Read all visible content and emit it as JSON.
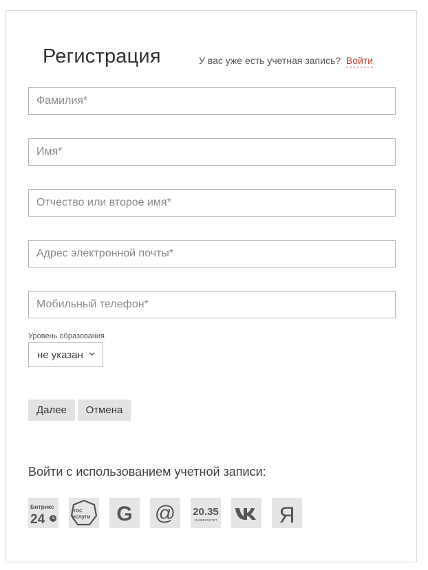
{
  "header": {
    "title": "Регистрация",
    "login_prompt": "У вас уже есть учетная запись?",
    "login_link": "Войти"
  },
  "form": {
    "fields": [
      {
        "placeholder": "Фамилия*",
        "value": ""
      },
      {
        "placeholder": "Имя*",
        "value": ""
      },
      {
        "placeholder": "Отчество или второе имя*",
        "value": ""
      },
      {
        "placeholder": "Адрес электронной почты*",
        "value": ""
      },
      {
        "placeholder": "Мобильный телефон*",
        "value": ""
      }
    ],
    "education": {
      "label": "Уровень образования",
      "selected": "не указан"
    },
    "next_label": "Далее",
    "cancel_label": "Отмена"
  },
  "social": {
    "title": "Войти с использованием учетной записи:",
    "providers": [
      {
        "name": "Bitrix24",
        "icon": "bitrix24-icon",
        "text_top": "Битрикс",
        "text_bottom": "24"
      },
      {
        "name": "Gosuslugi",
        "icon": "gosuslugi-icon",
        "text_top": "гос",
        "text_bottom": "услуги"
      },
      {
        "name": "Google",
        "icon": "google-icon",
        "text": "G"
      },
      {
        "name": "Mail.ru",
        "icon": "mailru-icon",
        "text": "@"
      },
      {
        "name": "Universitet 20.35",
        "icon": "university-2035-icon",
        "text_top": "20.35",
        "text_bottom": "УНИВЕРСИТЕТ"
      },
      {
        "name": "VK",
        "icon": "vk-icon",
        "text": "vk"
      },
      {
        "name": "Yandex",
        "icon": "yandex-icon",
        "text": "Я"
      }
    ]
  },
  "colors": {
    "accent": "#c0392b",
    "button_bg": "#e2e2e2",
    "social_bg": "#e5e5e5",
    "border": "#b7b7b7"
  }
}
